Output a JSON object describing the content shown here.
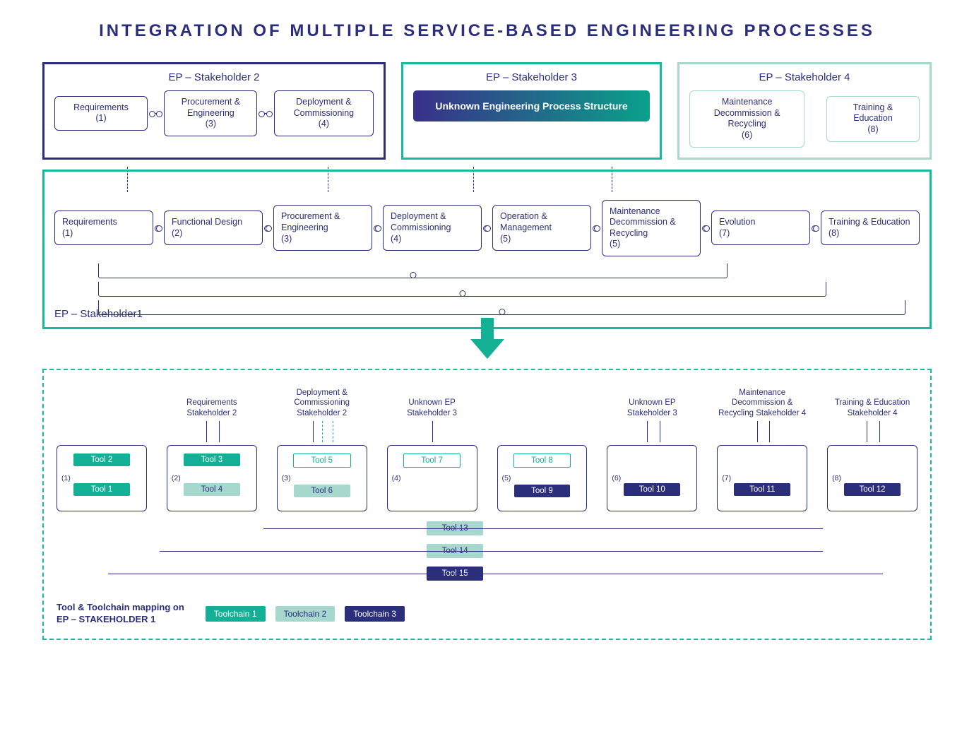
{
  "title": "INTEGRATION OF MULTIPLE SERVICE-BASED ENGINEERING PROCESSES",
  "stakeholders_top": {
    "s2": {
      "title": "EP – Stakeholder 2",
      "steps": [
        "Requirements\n(1)",
        "Procurement & Engineering\n(3)",
        "Deployment & Commissioning\n(4)"
      ]
    },
    "s3": {
      "title": "EP – Stakeholder 3",
      "tile": "Unknown Engineering Process Structure"
    },
    "s4": {
      "title": "EP – Stakeholder 4",
      "steps": [
        "Maintenance Decommission & Recycling\n(6)",
        "Training & Education\n(8)"
      ]
    }
  },
  "stakeholder1": {
    "label": "EP – Stakeholder1",
    "steps": [
      "Requirements\n(1)",
      "Functional Design\n(2)",
      "Procurement & Engineering\n(3)",
      "Deployment & Commissioning\n(4)",
      "Operation & Management\n(5)",
      "Maintenance Decommission & Recycling\n(5)",
      "Evolution\n(7)",
      "Training & Education\n(8)"
    ]
  },
  "mapping": {
    "annotations": [
      "",
      "Requirements Stakeholder 2",
      "Deployment & Commissioning Stakeholder 2",
      "Unknown EP Stakeholder 3",
      "",
      "Unknown EP Stakeholder 3",
      "Maintenance Decommission & Recycling Stakeholder 4",
      "Training & Education Stakeholder 4"
    ],
    "cells": [
      {
        "idx": "(1)",
        "tools": [
          {
            "name": "Tool 2",
            "cls": "tc1"
          },
          {
            "name": "Tool 1",
            "cls": "tc1"
          }
        ]
      },
      {
        "idx": "(2)",
        "tools": [
          {
            "name": "Tool 3",
            "cls": "tc1"
          },
          {
            "name": "Tool 4",
            "cls": "tc2"
          }
        ]
      },
      {
        "idx": "(3)",
        "tools": [
          {
            "name": "Tool 5",
            "cls": "tc-outline"
          },
          {
            "name": "Tool 6",
            "cls": "tc2"
          }
        ]
      },
      {
        "idx": "(4)",
        "tools": [
          {
            "name": "Tool 7",
            "cls": "tc-outline"
          }
        ]
      },
      {
        "idx": "(5)",
        "tools": [
          {
            "name": "Tool 8",
            "cls": "tc-outline"
          },
          {
            "name": "Tool 9",
            "cls": "tc3"
          }
        ]
      },
      {
        "idx": "(6)",
        "tools": [
          {
            "name": "Tool 10",
            "cls": "tc3"
          }
        ]
      },
      {
        "idx": "(7)",
        "tools": [
          {
            "name": "Tool 11",
            "cls": "tc3"
          }
        ]
      },
      {
        "idx": "(8)",
        "tools": [
          {
            "name": "Tool 12",
            "cls": "tc3"
          }
        ]
      }
    ],
    "bars": [
      {
        "name": "Tool 13",
        "cls": "tc2"
      },
      {
        "name": "Tool 14",
        "cls": "tc2"
      },
      {
        "name": "Tool 15",
        "cls": "tc3"
      }
    ],
    "footer": {
      "label_l1": "Tool & Toolchain mapping on",
      "label_l2": "EP – STAKEHOLDER 1",
      "legend": [
        "Toolchain 1",
        "Toolchain 2",
        "Toolchain 3"
      ]
    }
  }
}
